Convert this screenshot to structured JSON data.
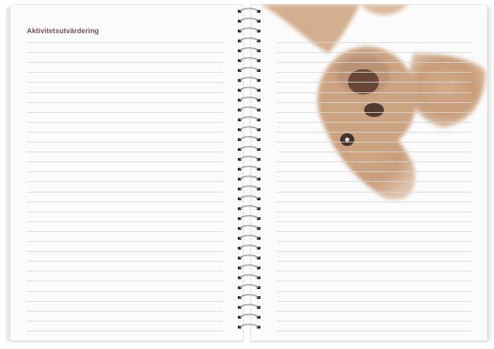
{
  "notebook": {
    "left_page": {
      "heading": "Aktivitetsutvärdering"
    },
    "right_page": {
      "image": "dog-photo"
    }
  },
  "colors": {
    "heading": "#7a4d52",
    "rule_line": "#d7d7d7",
    "paper": "#fbfbfb",
    "dog_fur": "#b8865a"
  }
}
